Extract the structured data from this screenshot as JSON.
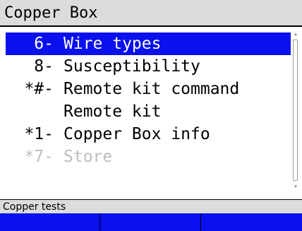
{
  "window": {
    "title": "Copper Box"
  },
  "menu": {
    "items": [
      {
        "prefix": "6-",
        "label": "Wire types",
        "selected": true,
        "disabled": false
      },
      {
        "prefix": "8-",
        "label": "Susceptibility",
        "selected": false,
        "disabled": false
      },
      {
        "prefix": "*#-",
        "label": "Remote kit command",
        "selected": false,
        "disabled": false
      },
      {
        "prefix": "",
        "label": "Remote kit",
        "selected": false,
        "disabled": false
      },
      {
        "prefix": "*1-",
        "label": "Copper Box info",
        "selected": false,
        "disabled": false
      },
      {
        "prefix": "*7-",
        "label": "Store",
        "selected": false,
        "disabled": true
      }
    ]
  },
  "status": {
    "text": "Copper tests"
  },
  "softkeys": [
    "",
    "",
    ""
  ],
  "colors": {
    "selection": "#0a10ee",
    "title_bg": "#dcdcdc",
    "disabled_text": "#bdbdbd"
  }
}
